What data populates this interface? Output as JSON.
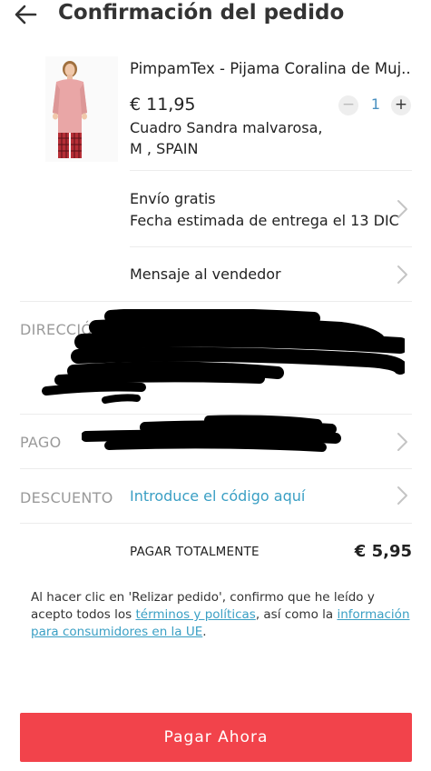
{
  "header": {
    "title": "Confirmación del pedido",
    "back_icon": "arrow-left-icon"
  },
  "product": {
    "title": "PimpamTex - Pijama Coralina de Muj...",
    "price": "€ 11,95",
    "quantity": "1",
    "qty_minus": "−",
    "qty_plus": "+",
    "desc_line1": "Cuadro Sandra malvarosa,",
    "desc_line2": "M ,  SPAIN"
  },
  "shipping": {
    "line1": "Envío gratis",
    "line2": "Fecha estimada de entrega el 13 DIC"
  },
  "seller_message": {
    "label": "Mensaje al vendedor"
  },
  "address": {
    "label": "DIRECCIÓN"
  },
  "payment": {
    "label": "PAGO"
  },
  "discount": {
    "label": "DESCUENTO",
    "link": "Introduce el código aquí"
  },
  "total": {
    "label": "PAGAR TOTALMENTE",
    "value": "€ 5,95"
  },
  "legal": {
    "prefix": "Al hacer clic en 'Relizar pedido', confirmo que he leído y acepto todos los ",
    "terms_link": "términos y políticas",
    "middle": ", así como la ",
    "info_link": "información para consumidores en la UE",
    "suffix": "."
  },
  "pay_button": {
    "label": "Pagar Ahora"
  },
  "colors": {
    "accent": "#f2434b",
    "link": "#3a9fc4",
    "muted": "#9a9a9a"
  }
}
